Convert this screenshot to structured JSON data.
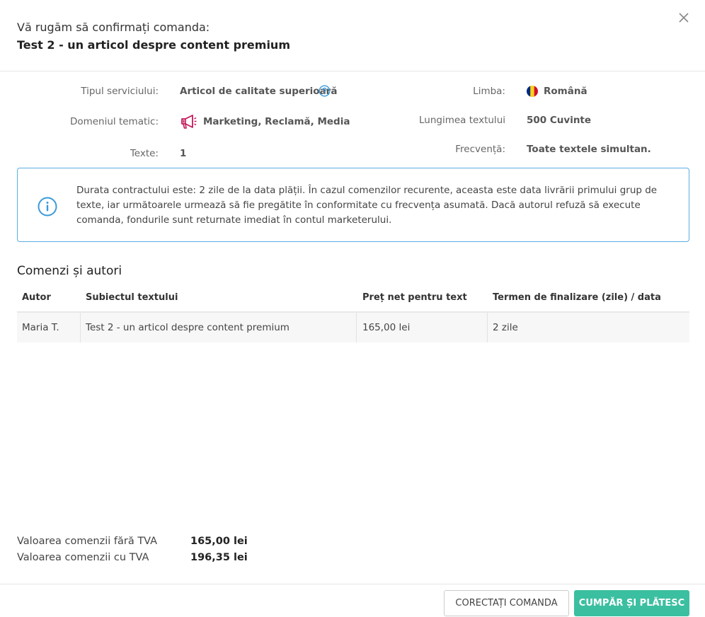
{
  "header": {
    "title": "Vă rugăm să confirmați comanda:",
    "subtitle": "Test 2 - un articol despre content premium",
    "close_icon": "close-icon"
  },
  "details": {
    "service_type_label": "Tipul serviciului:",
    "service_type_value": "Articol de calitate superioară",
    "service_help_icon": "question-circle-icon",
    "domain_label": "Domeniul tematic:",
    "domain_value": "Marketing, Reclamă, Media",
    "domain_icon": "megaphone-icon",
    "texts_label": "Texte:",
    "texts_value": "1",
    "language_label": "Limba:",
    "language_value": "Română",
    "language_icon": "romania-flag-icon",
    "length_label": "Lungimea textului",
    "length_value": "500 Cuvinte",
    "frequency_label": "Frecvență:",
    "frequency_value": "Toate textele simultan."
  },
  "info": {
    "icon": "info-icon",
    "text": "Durata contractului este: 2 zile de la data plății. În cazul comenzilor recurente, aceasta este data livrării primului grup de texte, iar următoarele urmează să fie pregătite în conformitate cu frecvența asumată. Dacă autorul refuză să execute comanda, fondurile sunt returnate imediat în contul marketerului."
  },
  "orders": {
    "title": "Comenzi și autori",
    "columns": [
      "Autor",
      "Subiectul textului",
      "Preț net pentru text",
      "Termen de finalizare (zile) / data"
    ],
    "rows": [
      [
        "Maria T.",
        "Test 2 - un articol despre content premium",
        "165,00 lei",
        "2 zile"
      ]
    ]
  },
  "summary": {
    "net_label": "Valoarea comenzii fără TVA",
    "net_value": "165,00 lei",
    "gross_label": "Valoarea comenzii cu TVA",
    "gross_value": "196,35 lei"
  },
  "buttons": {
    "correct": "CORECTAȚI COMANDA",
    "buy": "CUMPĂR ȘI PLĂTESC"
  },
  "colors": {
    "accent": "#3bbfa1",
    "info_border": "#5aaee0",
    "icon_red": "#c2185b"
  }
}
